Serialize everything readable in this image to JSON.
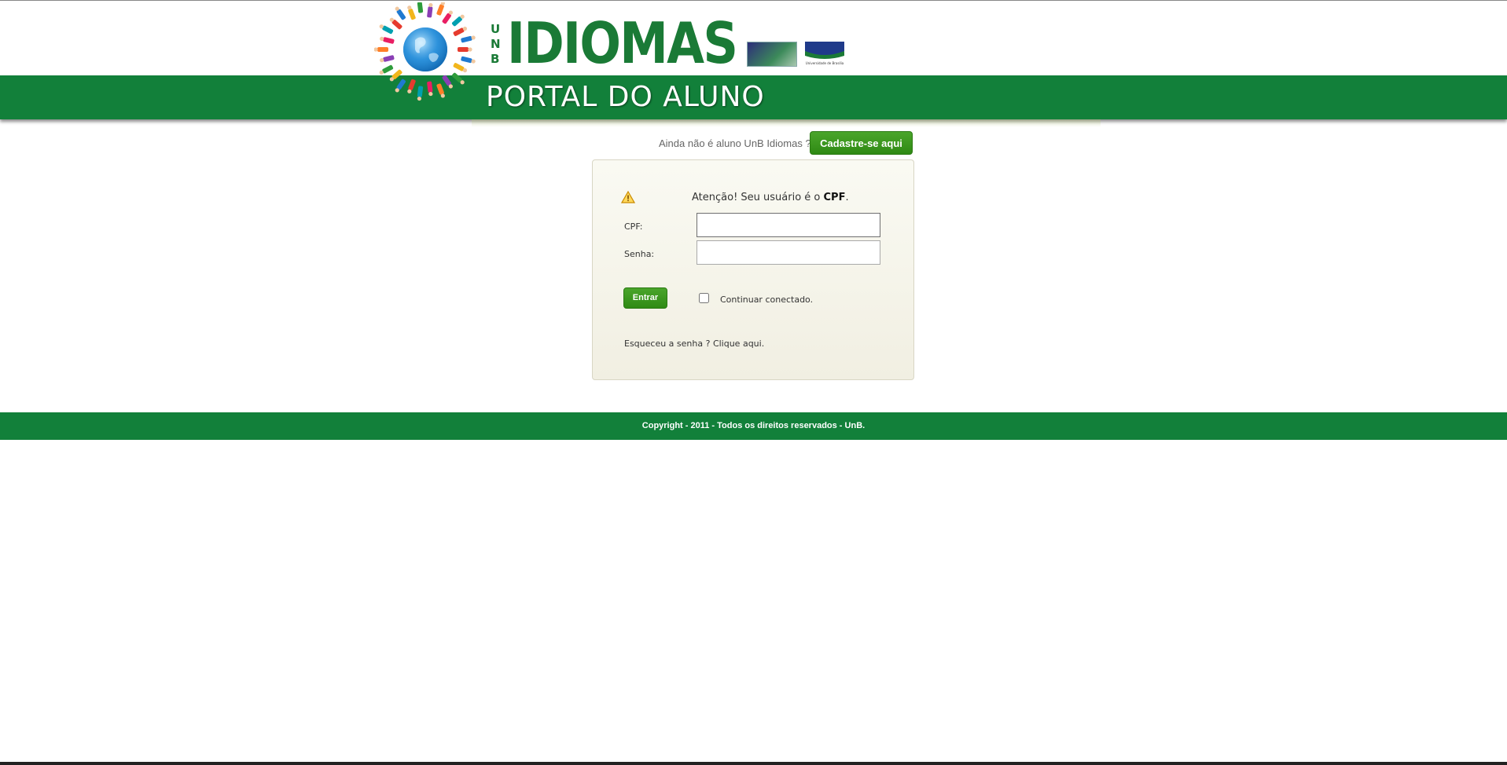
{
  "header": {
    "brand_small": [
      "U",
      "N",
      "B"
    ],
    "brand_name": "IDIOMAS",
    "portal_title": "PORTAL DO ALUNO",
    "brand_color": "#12803a",
    "logos": [
      "globe-people-logo",
      "unb-idiomas-emblem",
      "universidade-de-brasilia-logo"
    ],
    "logo_caption": "Universidade de Brasília"
  },
  "signup": {
    "prompt": "Ainda não é aluno UnB Idiomas ?",
    "button_label": "Cadastre-se aqui"
  },
  "login": {
    "warning_prefix": "Atenção! Seu usuário é o ",
    "warning_bold": "CPF",
    "warning_suffix": ".",
    "cpf_label": "CPF:",
    "cpf_value": "",
    "password_label": "Senha:",
    "password_value": "",
    "enter_label": "Entrar",
    "remember_label": "Continuar conectado.",
    "remember_checked": false,
    "forgot_label": "Esqueceu a senha ? Clique aqui."
  },
  "footer": {
    "copyright": "Copyright - 2011 - Todos os direitos reservados - UnB."
  },
  "colors": {
    "accent": "#12803a",
    "button": "#3a961f",
    "panel": "#f4f2e7"
  }
}
